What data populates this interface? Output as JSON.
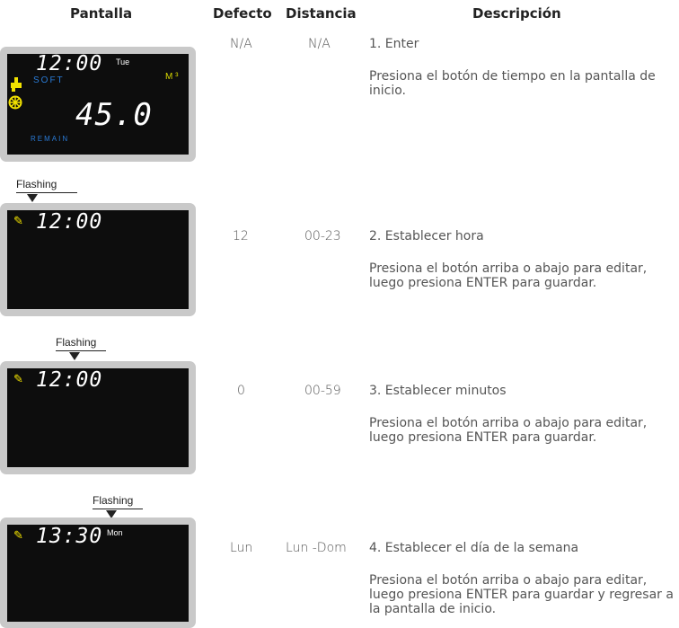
{
  "headers": {
    "display": "Pantalla",
    "default": "Defecto",
    "range": "Distancia",
    "description": "Descripción"
  },
  "rows": [
    {
      "default": "N/A",
      "range": "N/A",
      "step": "1. Enter",
      "detail": "Presiona el botón de tiempo en la pantalla de inicio.",
      "lcd": {
        "time": "12:00",
        "day": "Tue",
        "mode": "SOFT",
        "value": "45.0",
        "unit": "M ³",
        "status": "REMAIN"
      }
    },
    {
      "default": "12",
      "range": "00-23",
      "step": "2. Establecer hora",
      "detail": "Presiona el botón arriba o abajo para editar, luego presiona ENTER para guardar.",
      "flash": "Flashing",
      "lcd": {
        "time": "12:00"
      }
    },
    {
      "default": "0",
      "range": "00-59",
      "step": "3. Establecer minutos",
      "detail": "Presiona el botón arriba o abajo para editar, luego presiona ENTER para guardar.",
      "flash": "Flashing",
      "lcd": {
        "time": "12:00"
      }
    },
    {
      "default": "Lun",
      "range": "Lun -Dom",
      "step": "4. Establecer el día de la semana",
      "detail": "Presiona el botón arriba o abajo para editar, luego presiona ENTER para guardar y regresar a la pantalla de inicio.",
      "flash": "Flashing",
      "lcd": {
        "time": "13:30",
        "day": "Mon"
      }
    }
  ],
  "colors": {
    "lcd_bg": "#0d0d0d",
    "frame": "#c9c9c9",
    "soft_blue": "#2a7bd6",
    "unit_yellow": "#d8d800",
    "icon_yellow": "#f2e200"
  },
  "icons": {
    "pencil": "pencil-icon",
    "tap": "faucet-icon",
    "snow": "salt-icon"
  }
}
